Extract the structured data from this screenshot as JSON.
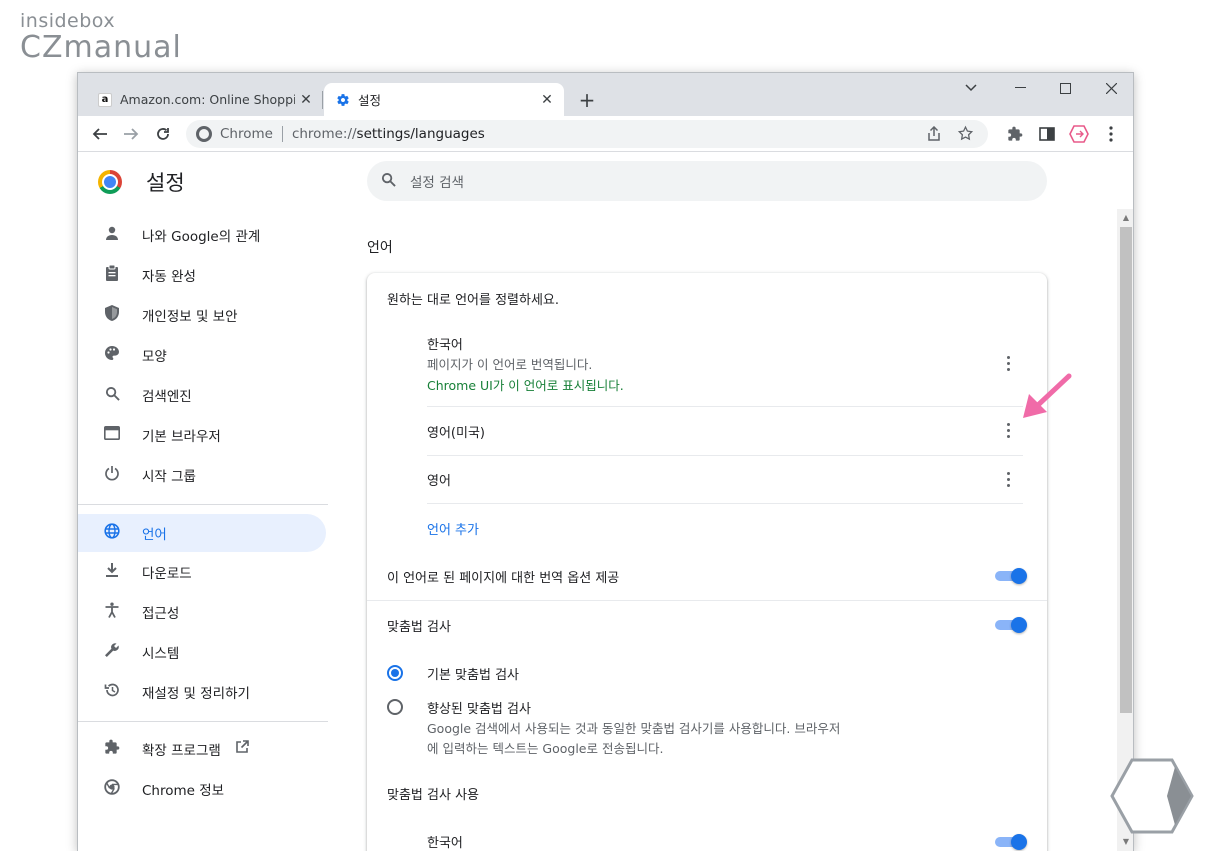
{
  "watermark": {
    "top": "insidebox",
    "main": "CZmanual"
  },
  "tabs": [
    {
      "label": "Amazon.com: Online Shopping",
      "favicon": "amazon-icon"
    },
    {
      "label": "설정",
      "favicon": "gear-icon"
    }
  ],
  "toolbar": {
    "omnibox_site": "Chrome",
    "omnibox_url_prefix": "chrome://",
    "omnibox_url_path": "settings/languages"
  },
  "sidebar": {
    "title": "설정",
    "items": [
      {
        "label": "나와 Google의 관계",
        "icon": "person-icon"
      },
      {
        "label": "자동 완성",
        "icon": "clipboard-icon"
      },
      {
        "label": "개인정보 및 보안",
        "icon": "shield-icon"
      },
      {
        "label": "모양",
        "icon": "palette-icon"
      },
      {
        "label": "검색엔진",
        "icon": "search-icon"
      },
      {
        "label": "기본 브라우저",
        "icon": "browser-icon"
      },
      {
        "label": "시작 그룹",
        "icon": "power-icon"
      },
      {
        "label": "언어",
        "icon": "globe-icon"
      },
      {
        "label": "다운로드",
        "icon": "download-icon"
      },
      {
        "label": "접근성",
        "icon": "accessibility-icon"
      },
      {
        "label": "시스템",
        "icon": "wrench-icon"
      },
      {
        "label": "재설정 및 정리하기",
        "icon": "history-icon"
      },
      {
        "label": "확장 프로그램",
        "icon": "puzzle-icon"
      },
      {
        "label": "Chrome 정보",
        "icon": "chrome-icon"
      }
    ]
  },
  "search": {
    "placeholder": "설정 검색"
  },
  "section_title": "언어",
  "card": {
    "header": "원하는 대로 언어를 정렬하세요.",
    "languages": [
      {
        "name": "한국어",
        "line1": "페이지가 이 언어로 번역됩니다.",
        "line2": "Chrome UI가 이 언어로 표시됩니다."
      },
      {
        "name": "영어(미국)"
      },
      {
        "name": "영어"
      }
    ],
    "add_language": "언어 추가",
    "translate_offer": "이 언어로 된 페이지에 대한 번역 옵션 제공",
    "spellcheck": "맞춤법 검사",
    "basic_spellcheck": "기본 맞춤법 검사",
    "enhanced_spellcheck": "향상된 맞춤법 검사",
    "enhanced_desc1": "Google 검색에서 사용되는 것과 동일한 맞춤법 검사기를 사용합니다. 브라우저",
    "enhanced_desc2": "에 입력하는 텍스트는 Google로 전송됩니다.",
    "use_spellcheck": "맞춤법 검사 사용",
    "spellcheck_lang": "한국어"
  },
  "colors": {
    "accent": "#1a73e8",
    "active_bg": "#e8f0fe",
    "green": "#188038",
    "arrow": "#f06ba8"
  }
}
